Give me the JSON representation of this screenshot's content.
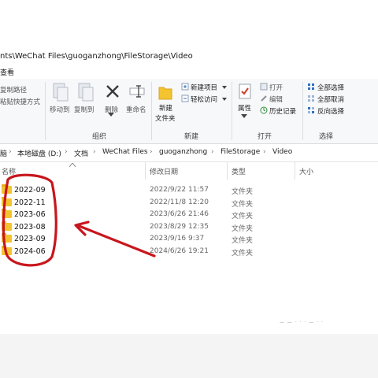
{
  "window": {
    "title_path": "nts\\WeChat Files\\guoganzhong\\FileStorage\\Video",
    "menu_tab": "查看"
  },
  "ribbon": {
    "copy_path": "复制路径",
    "paste_shortcut": "粘贴快捷方式",
    "move_to": "移动到",
    "copy_to": "复制到",
    "delete": "删除",
    "rename": "重命名",
    "group_organize": "组织",
    "new_folder_line1": "新建",
    "new_folder_line2": "文件夹",
    "new_item": "新建项目",
    "easy_access": "轻松访问",
    "group_new": "新建",
    "properties": "属性",
    "open": "打开",
    "edit": "编辑",
    "history": "历史记录",
    "group_open": "打开",
    "select_all": "全部选择",
    "select_none": "全部取消",
    "invert_selection": "反向选择",
    "group_select": "选择"
  },
  "breadcrumb": [
    "脑",
    "本地磁盘 (D:)",
    "文档",
    "WeChat Files",
    "guoganzhong",
    "FileStorage",
    "Video"
  ],
  "columns": {
    "name": "名称",
    "date": "修改日期",
    "type": "类型",
    "size": "大小"
  },
  "files": [
    {
      "name": "2022-09",
      "date": "2022/9/22 11:57",
      "type": "文件夹"
    },
    {
      "name": "2022-11",
      "date": "2022/11/8 12:20",
      "type": "文件夹"
    },
    {
      "name": "2023-06",
      "date": "2023/6/26 21:46",
      "type": "文件夹"
    },
    {
      "name": "2023-08",
      "date": "2023/8/29 12:35",
      "type": "文件夹"
    },
    {
      "name": "2023-09",
      "date": "2023/9/16 9:37",
      "type": "文件夹"
    },
    {
      "name": "2024-06",
      "date": "2024/6/26 19:21",
      "type": "文件夹"
    }
  ],
  "colors": {
    "annotation": "#c8161d",
    "folder": "#f4c430",
    "window_bg": "#ffffff"
  },
  "icons": [
    "folder-icon",
    "scissors-icon",
    "delete-x-icon",
    "properties-check-icon",
    "history-icon",
    "select-all-icon"
  ]
}
